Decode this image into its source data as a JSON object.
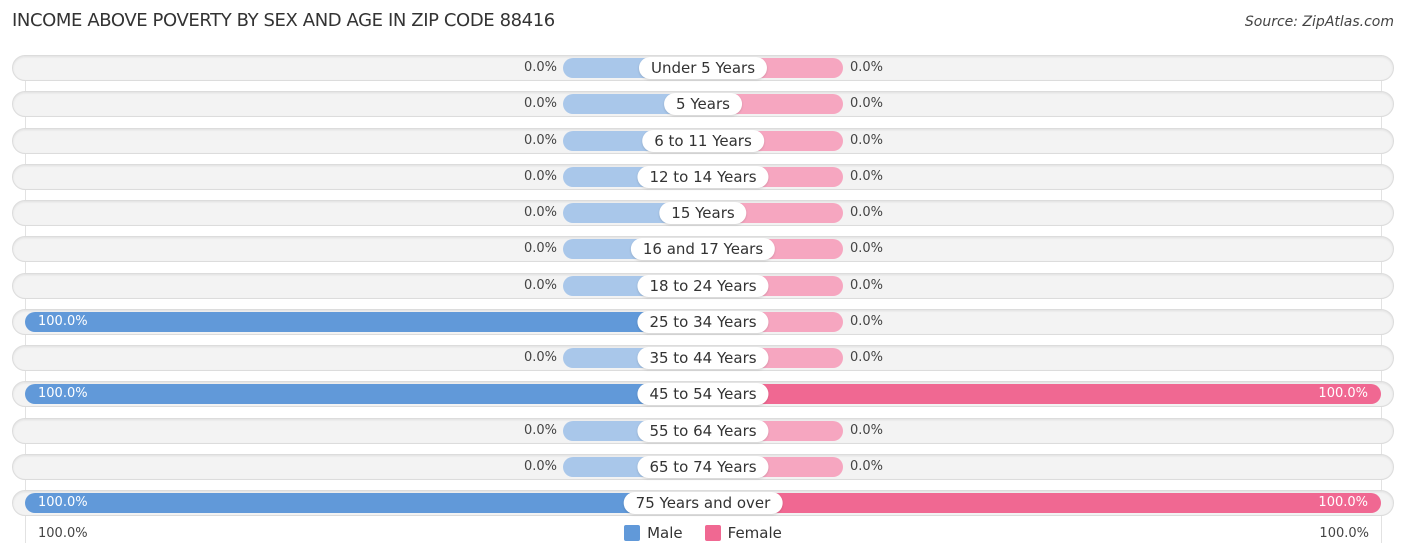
{
  "header": {
    "title": "INCOME ABOVE POVERTY BY SEX AND AGE IN ZIP CODE 88416",
    "source": "Source: ZipAtlas.com"
  },
  "colors": {
    "male_full": "#6199d9",
    "male_stub": "#a9c7ea",
    "female_full": "#f06892",
    "female_stub": "#f6a6c0",
    "row_bg": "#f3f3f3"
  },
  "legend": [
    {
      "label": "Male",
      "color": "#6199d9"
    },
    {
      "label": "Female",
      "color": "#f06892"
    }
  ],
  "axis": {
    "left_label": "100.0%",
    "right_label": "100.0%"
  },
  "chart_data": {
    "type": "bar",
    "orientation": "horizontal-diverging",
    "title": "INCOME ABOVE POVERTY BY SEX AND AGE IN ZIP CODE 88416",
    "xlabel": "",
    "ylabel": "",
    "xlim": [
      -100,
      100
    ],
    "categories": [
      "Under 5 Years",
      "5 Years",
      "6 to 11 Years",
      "12 to 14 Years",
      "15 Years",
      "16 and 17 Years",
      "18 to 24 Years",
      "25 to 34 Years",
      "35 to 44 Years",
      "45 to 54 Years",
      "55 to 64 Years",
      "65 to 74 Years",
      "75 Years and over"
    ],
    "series": [
      {
        "name": "Male",
        "values": [
          0,
          0,
          0,
          0,
          0,
          0,
          0,
          100,
          0,
          100,
          0,
          0,
          100
        ],
        "labels": [
          "0.0%",
          "0.0%",
          "0.0%",
          "0.0%",
          "0.0%",
          "0.0%",
          "0.0%",
          "100.0%",
          "0.0%",
          "100.0%",
          "0.0%",
          "0.0%",
          "100.0%"
        ]
      },
      {
        "name": "Female",
        "values": [
          0,
          0,
          0,
          0,
          0,
          0,
          0,
          0,
          0,
          100,
          0,
          0,
          100
        ],
        "labels": [
          "0.0%",
          "0.0%",
          "0.0%",
          "0.0%",
          "0.0%",
          "0.0%",
          "0.0%",
          "0.0%",
          "0.0%",
          "100.0%",
          "0.0%",
          "0.0%",
          "100.0%"
        ]
      }
    ],
    "legend_position": "bottom-center",
    "grid": false
  }
}
